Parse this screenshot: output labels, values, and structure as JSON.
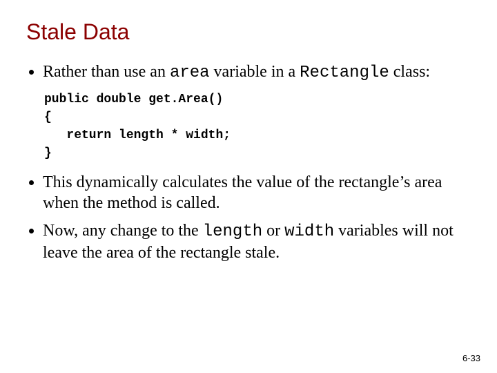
{
  "title": "Stale Data",
  "bullets": {
    "b1_pre": "Rather than use an ",
    "b1_code1": "area",
    "b1_mid": " variable in a ",
    "b1_code2": "Rectangle",
    "b1_post": " class:",
    "code": "public double get.Area()\n{\n   return length * width;\n}",
    "b2": "This dynamically calculates the value of the rectangle’s area when the method is called.",
    "b3_pre": "Now, any change to the ",
    "b3_code1": "length",
    "b3_mid": " or ",
    "b3_code2": "width",
    "b3_post": " variables will not leave the area of the rectangle stale."
  },
  "page_number": "6-33"
}
